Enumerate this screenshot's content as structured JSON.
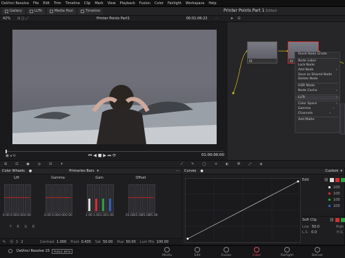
{
  "menubar": {
    "app": "DaVinci Resolve",
    "items": [
      "File",
      "Edit",
      "Trim",
      "Timeline",
      "Clip",
      "Mark",
      "View",
      "Playback",
      "Fusion",
      "Color",
      "Fairlight",
      "Workspace",
      "Help"
    ]
  },
  "topbar": {
    "gallery": "Gallery",
    "luts": "LUTs",
    "media_pool": "Media Pool",
    "timeline": "Timeline",
    "project_title": "Printer Points Part 1",
    "edited": "Edited"
  },
  "viewerbar": {
    "zoom": "42%",
    "clip_name": "Printer Points Part1",
    "timecode": "00:01:06:22"
  },
  "transport": {
    "timecode": "01:00:00:00"
  },
  "nodes": {
    "node1": "01",
    "node2": "02"
  },
  "context_menu": [
    "Reset Node Grade",
    "Node Label",
    "Lock Node",
    "Add Node",
    "Save as Shared Node",
    "Delete Node",
    "HDR Mode",
    "Node Cache",
    "LUTs",
    "Color Space",
    "Gamma",
    "Channels",
    "Add Matte"
  ],
  "color_wheels": {
    "title": "Color Wheels",
    "mode": "Primaries Bars",
    "wheels": [
      {
        "label": "Lift",
        "values": [
          "0.00",
          "0.00",
          "0.00",
          "0.00"
        ]
      },
      {
        "label": "Gamma",
        "values": [
          "0.00",
          "0.00",
          "0.00",
          "0.00"
        ]
      },
      {
        "label": "Gain",
        "values": [
          "1.00",
          "1.00",
          "1.00",
          "1.00"
        ]
      },
      {
        "label": "Offset",
        "values": [
          "25.00",
          "25.00",
          "25.00",
          "25.00"
        ]
      }
    ],
    "channels": [
      "Y",
      "R",
      "G",
      "B"
    ],
    "footer": {
      "contrast_label": "Contrast",
      "contrast": "1.000",
      "pivot_label": "Pivot",
      "pivot": "0.435",
      "sat_label": "Sat",
      "sat": "50.00",
      "hue_label": "Hue",
      "hue": "50.00",
      "lummix_label": "Lum Mix",
      "lummix": "100.00"
    }
  },
  "curves": {
    "title": "Curves",
    "mode": "Custom",
    "edit": "Edit",
    "soft_clip": "Soft Clip",
    "low": "Low",
    "low_val": "50.0",
    "high": "High",
    "ls": "L.S.",
    "ls_val": "0.0",
    "hs": "H.S.",
    "edit_vals": [
      "100",
      "100",
      "100",
      "100"
    ]
  },
  "bottom": {
    "brand": "DaVinci Resolve 15",
    "badge": "PUBLIC BETA",
    "pages": [
      "Media",
      "Edit",
      "Fusion",
      "Color",
      "Fairlight",
      "Deliver"
    ],
    "active": "Color"
  },
  "colors": {
    "accent": "#e24d5b",
    "active_page": "#e24d5b",
    "red": "#d03030",
    "green": "#30a040",
    "blue": "#3060c0"
  }
}
